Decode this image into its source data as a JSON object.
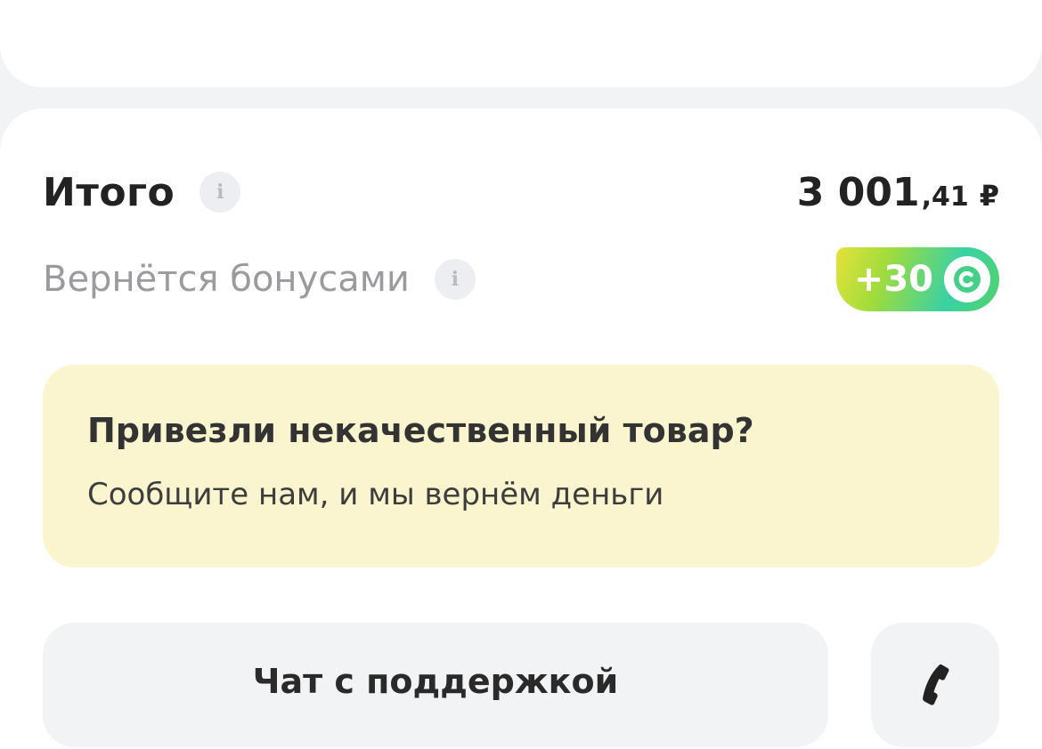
{
  "summary": {
    "total_label": "Итого",
    "total_amount": "3 001",
    "total_cents": ",41",
    "total_currency": "₽",
    "bonus_label": "Вернётся бонусами",
    "bonus_amount": "+30",
    "info_icon_glyph": "i"
  },
  "promo": {
    "title": "Привезли некачественный товар?",
    "subtitle": "Сообщите нам, и мы вернём деньги"
  },
  "actions": {
    "chat_label": "Чат с поддержкой",
    "call_icon": "phone-icon"
  },
  "colors": {
    "page_bg": "#f2f3f5",
    "card_bg": "#ffffff",
    "promo_bg": "#fbf5cf",
    "text_primary": "#222222",
    "text_muted": "#9a9a9f",
    "bonus_gradient_start": "#e6e23a",
    "bonus_gradient_end": "#52d36a"
  }
}
